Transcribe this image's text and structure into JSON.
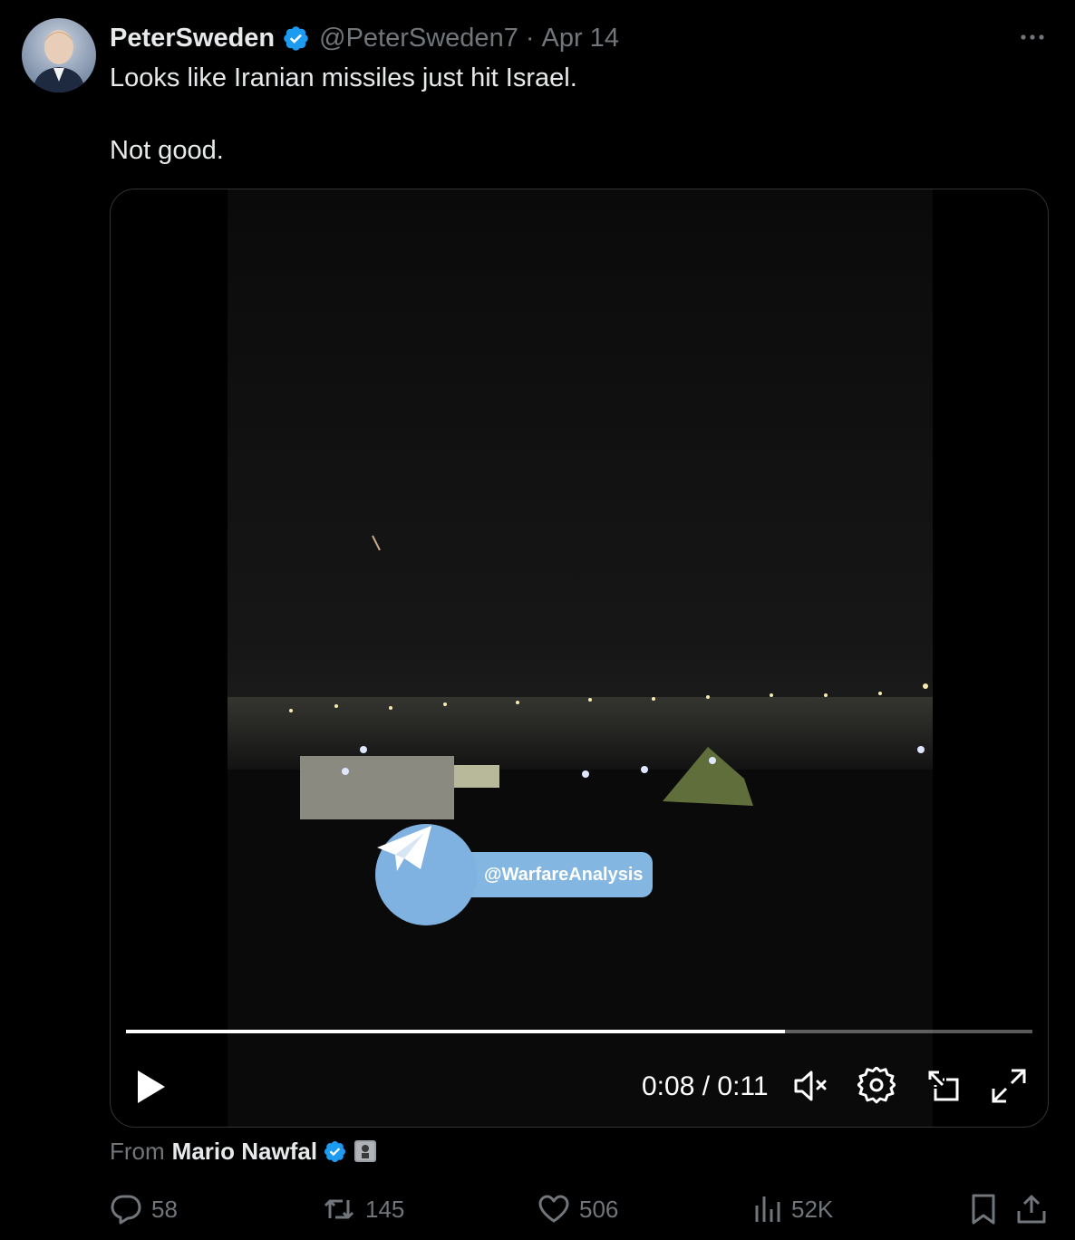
{
  "tweet": {
    "display_name": "PeterSweden",
    "handle": "@PeterSweden7",
    "separator": "·",
    "date": "Apr 14",
    "text_line1": "Looks like Iranian missiles just hit Israel.",
    "text_line2": "Not good."
  },
  "video": {
    "watermark": "@WarfareAnalysis",
    "time_display": "0:08 / 0:11",
    "progress": 0.727
  },
  "source": {
    "from_label": "From",
    "author": "Mario Nawfal"
  },
  "actions": {
    "replies": "58",
    "reposts": "145",
    "likes": "506",
    "views": "52K"
  },
  "colors": {
    "background": "#000000",
    "text": "#e7e9ea",
    "muted": "#71767b",
    "verified": "#1d9bf0"
  }
}
